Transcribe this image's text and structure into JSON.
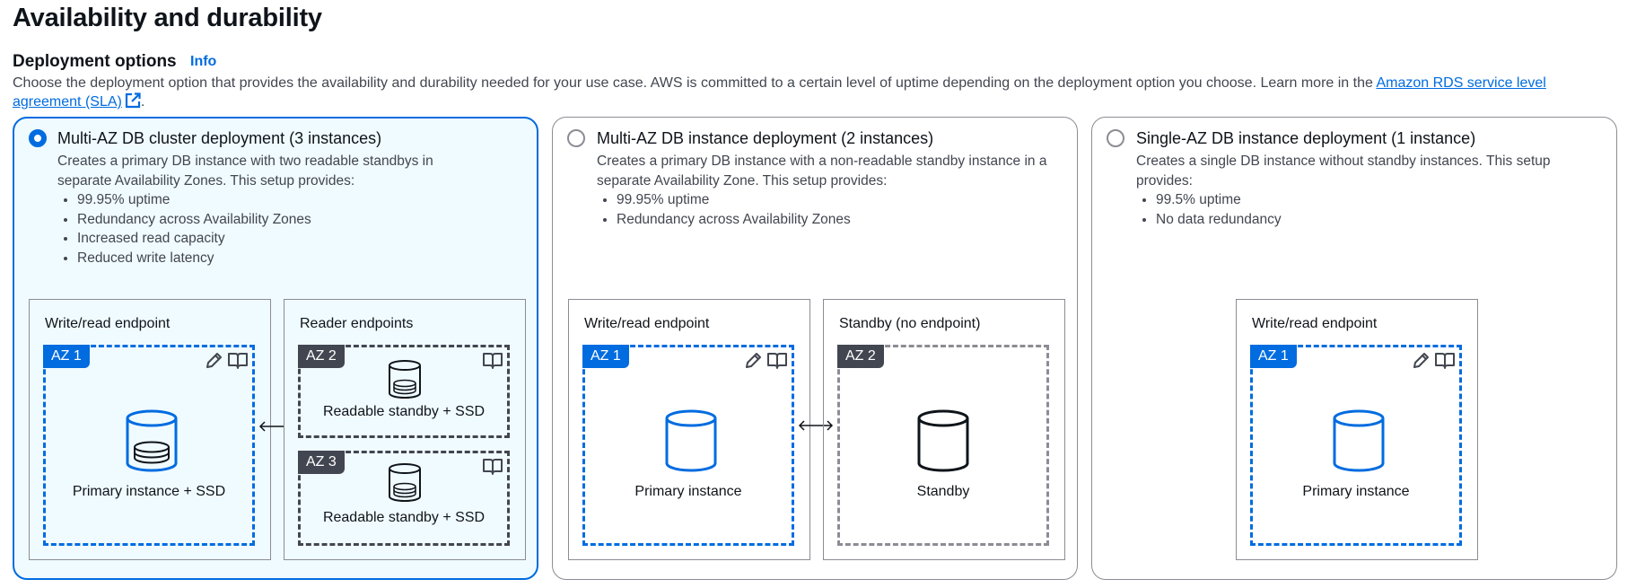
{
  "section": {
    "title": "Availability and durability",
    "subtitle": "Deployment options",
    "info_link": "Info",
    "description": "Choose the deployment option that provides the availability and durability needed for your use case. AWS is committed to a certain level of uptime depending on the deployment option you choose. Learn more in the",
    "sla_link": "Amazon RDS service level agreement (SLA)",
    "description_end": "."
  },
  "options": [
    {
      "title": "Multi-AZ DB cluster deployment (3 instances)",
      "selected": true,
      "description": "Creates a primary DB instance with two readable standbys in separate Availability Zones. This setup provides:",
      "bullets": [
        "99.95% uptime",
        "Redundancy across Availability Zones",
        "Increased read capacity",
        "Reduced write latency"
      ],
      "panel_left_label": "Write/read endpoint",
      "panel_right_label": "Reader endpoints",
      "az1": "AZ 1",
      "az2": "AZ 2",
      "az3": "AZ 3",
      "primary_label": "Primary instance + SSD",
      "standby1_label": "Readable standby + SSD",
      "standby2_label": "Readable standby + SSD"
    },
    {
      "title": "Multi-AZ DB instance deployment (2 instances)",
      "selected": false,
      "description": "Creates a primary DB instance with a non-readable standby instance in a separate Availability Zone. This setup provides:",
      "bullets": [
        "99.95% uptime",
        "Redundancy across Availability Zones"
      ],
      "panel_left_label": "Write/read endpoint",
      "panel_right_label": "Standby (no endpoint)",
      "az1": "AZ 1",
      "az2": "AZ 2",
      "primary_label": "Primary instance",
      "standby_label": "Standby"
    },
    {
      "title": "Single-AZ DB instance deployment (1 instance)",
      "selected": false,
      "description": "Creates a single DB instance without standby instances. This setup provides:",
      "bullets": [
        "99.5% uptime",
        "No data redundancy"
      ],
      "panel_label": "Write/read endpoint",
      "az1": "AZ 1",
      "primary_label": "Primary instance"
    }
  ],
  "colors": {
    "accent": "#006ce0",
    "dark": "#424650",
    "selected_bg": "#f0fbff"
  }
}
